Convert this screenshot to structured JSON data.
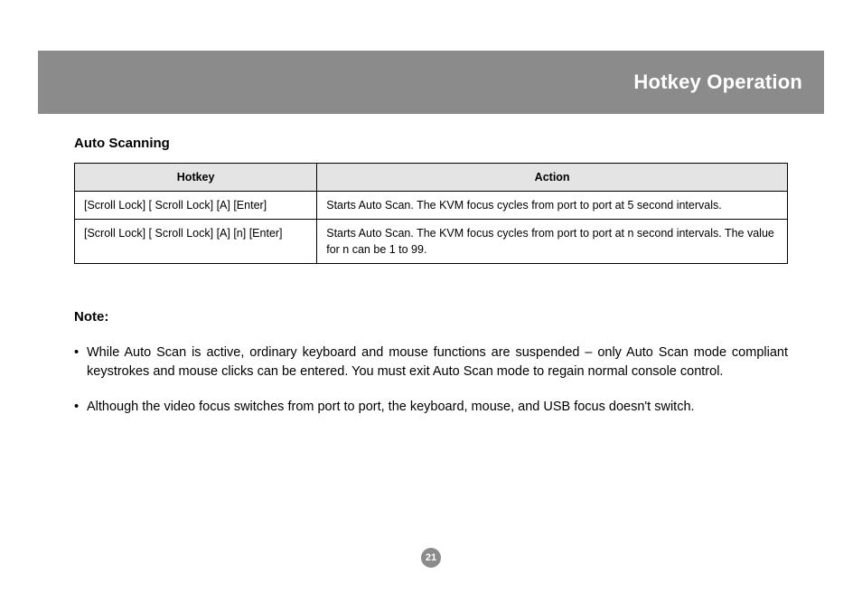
{
  "header": {
    "title": "Hotkey Operation"
  },
  "section": {
    "title": "Auto Scanning",
    "table": {
      "columns": [
        "Hotkey",
        "Action"
      ],
      "rows": [
        {
          "hotkey": "[Scroll Lock] [ Scroll Lock] [A] [Enter]",
          "action": "Starts Auto Scan.  The KVM focus cycles from port to port at 5 second intervals."
        },
        {
          "hotkey": "[Scroll Lock] [ Scroll Lock] [A] [n] [Enter]",
          "action": "Starts Auto Scan.  The KVM focus cycles from port to port at n second intervals. The value for n can be 1 to 99."
        }
      ]
    }
  },
  "note": {
    "title": "Note:",
    "items": [
      "While Auto Scan is active, ordinary keyboard and mouse functions are suspended – only Auto Scan mode compliant keystrokes and mouse clicks can be entered. You must exit Auto Scan mode to regain normal console control.",
      "Although the video focus switches from port to port, the keyboard, mouse, and USB focus doesn't switch."
    ]
  },
  "page_number": "21",
  "colors": {
    "header_bg": "#8c8b8b",
    "header_fg": "#ffffff",
    "th_bg": "#e4e4e4"
  }
}
